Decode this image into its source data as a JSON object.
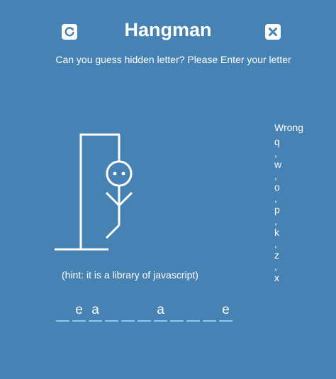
{
  "header": {
    "title": "Hangman",
    "instruction": "Can you guess hidden letter? Please Enter your letter",
    "restart_icon": "restart-icon",
    "close_icon": "close-icon"
  },
  "game": {
    "hint": "(hint: it is a library of javascript)",
    "word_slots": [
      "",
      "e",
      "a",
      "",
      "",
      "",
      "a",
      "",
      "",
      "",
      "e"
    ],
    "wrong_title": "Wrong",
    "wrong_letters": [
      "q",
      "w",
      "o",
      "p",
      "k",
      "z",
      "x"
    ],
    "separator": ","
  },
  "colors": {
    "background": "#4682b4",
    "foreground": "#ffffff",
    "slot_underline": "#8ec9ea"
  }
}
